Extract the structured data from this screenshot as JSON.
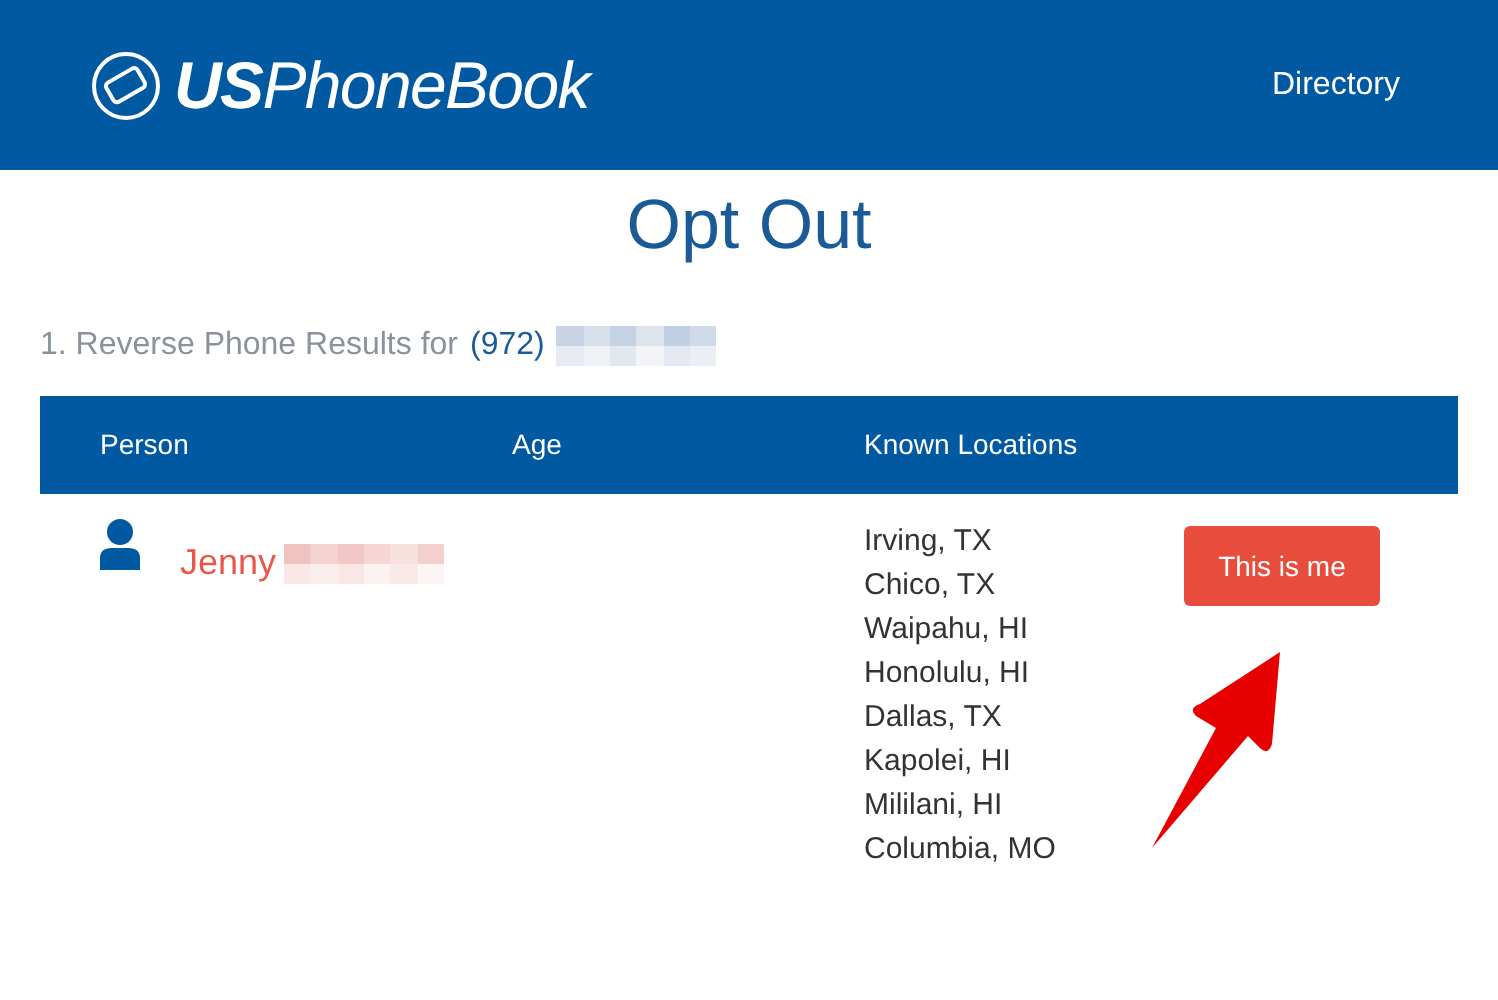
{
  "header": {
    "logo": "**US**PhoneBook",
    "nav": [
      "Directory"
    ]
  },
  "title": "Opt Out",
  "results": {
    "prefix": "1. Reverse Phone Results for",
    "area_code": "(972)"
  },
  "table": {
    "columns": [
      "Person",
      "Age",
      "Known Locations"
    ],
    "rows": [
      {
        "name": "Jenny",
        "locations": [
          "Irving, TX",
          "Chico, TX",
          "Waipahu, HI",
          "Honolulu, HI",
          "Dallas, TX",
          "Kapolei, HI",
          "Mililani, HI",
          "Columbia, MO"
        ],
        "button": "This is me"
      }
    ]
  }
}
